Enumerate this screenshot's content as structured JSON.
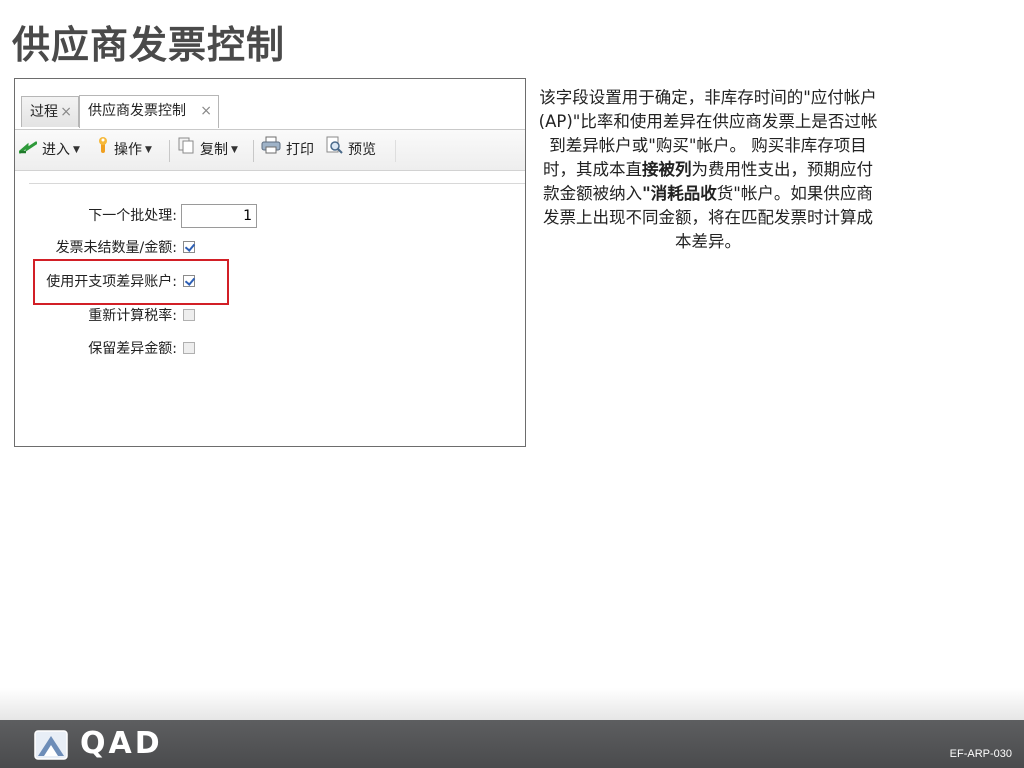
{
  "slide": {
    "title": "供应商发票控制"
  },
  "tabs": [
    {
      "label": "过程",
      "close": "×"
    },
    {
      "label": "供应商发票控制",
      "close": "×"
    }
  ],
  "toolbar": {
    "enter": "进入",
    "actions": "操作",
    "copy": "复制",
    "print": "打印",
    "preview": "预览"
  },
  "form": {
    "next_batch_label": "下一个批处理:",
    "next_batch_value": "1",
    "open_inv_label": "发票未结数量/金额:",
    "open_inv_checked": true,
    "expense_var_label": "使用开支项差异账户:",
    "expense_var_checked": true,
    "recalc_tax_label": "重新计算税率:",
    "recalc_tax_checked": false,
    "retain_var_label": "保留差异金额:",
    "retain_var_checked": false
  },
  "description": {
    "p1": "该字段设置用于确定，非库存时间的\"应付帐户 (AP)\"比率和使用差异在供应商发票上是否过帐到差异帐户或\"购买\"帐户。 购买非库存项目时，其成本直",
    "bold1": "接被列",
    "p2": "为费用性支出，预期应付款金额被纳入",
    "bold2": "\"消耗品收",
    "p3": "货\"帐户。如果供应商发票上出现不同金额，将在匹配发票时计算成本差异。"
  },
  "footer": {
    "logo": "QAD",
    "code": "EF-ARP-030"
  },
  "colors": {
    "highlight": "#d21f26",
    "footer": "#4a4b4d",
    "checkmark": "#2d5fb5"
  }
}
